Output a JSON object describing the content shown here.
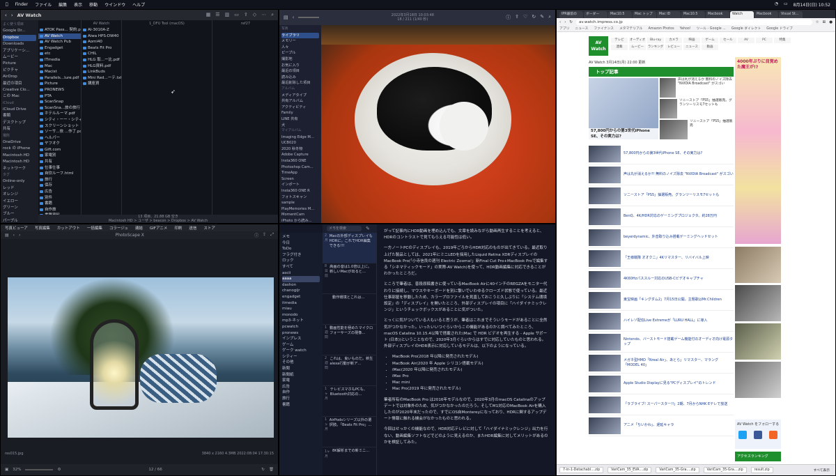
{
  "menubar": {
    "app": "Finder",
    "items": [
      "ファイル",
      "編集",
      "表示",
      "移動",
      "ウインドウ",
      "ヘルプ"
    ],
    "clock": "8月14日(日) 10:52"
  },
  "finder": {
    "title": "AV Watch",
    "sidebar": [
      "よく使う項目",
      "Google Dr...",
      "Dropbox",
      "Downloads",
      "アプリケーシ...",
      "ムービー",
      "Picture",
      "ピクチャ",
      "AirDrop",
      "最近の項目",
      "Creative Clo...",
      "この Mac",
      "iCloud",
      "iCloud Drive",
      "書類",
      "デスクトップ",
      "共有",
      "場所",
      "OneDrive",
      "rock の iPhone",
      "Macintosh HD",
      "Macintosh HD",
      "ネットワーク",
      "タグ",
      "Online-only",
      "レッド",
      "オレンジ",
      "イエロー",
      "グリーン",
      "ブルー",
      "パープル",
      "すべてのタグ..."
    ],
    "col_headers": [
      "",
      "AV Watch",
      "1_DFU Tool (macOS)",
      "ref27"
    ],
    "col1": [
      "ATOK Pass... 契約.pdf",
      "AV Watch",
      "AV Watch Pub",
      "Engadget",
      "etc",
      "ITmedia",
      "Mac",
      "Macist",
      "Parallels...lure.pdf",
      "Picture",
      "PRONEWS",
      "PTA",
      "ScanSnap",
      "ScanSna...旅の旅行",
      "ホテルルーマ.pdf",
      "シティ・ーー・シティ",
      "スクリーンショット",
      "ソーサ...依 ...作了.pdf",
      "ヘルパー",
      "ヤフオク",
      "Gift.com",
      "家電別",
      "共有",
      "仕事仕事",
      "自炊ルーフ.html",
      "旅行",
      "保存",
      "広告",
      "別件",
      "書籍",
      "自作旅",
      "書籍資料",
      "自身仕事",
      "写真",
      "夏休",
      "旅行",
      "タグ"
    ],
    "col2": [
      "AI-3010A-Z",
      "Aiwa HPS-DW40",
      "Aomi40",
      "Beats Fit Pro",
      "CHIL",
      "HLG 取...ー比.pdf",
      "HLG資料.pdf",
      "LinkBuds",
      "Mini Red...ーテ.txt",
      "講座資"
    ],
    "status": "13 項目、21.88 GB 空き",
    "path": "Macintosh HD > ユーザ > beacon > Dropbox > AV Watch"
  },
  "viewer": {
    "tabs": [
      "写真ビューア",
      "写真編集",
      "カットアウト",
      "一括編集",
      "コラージュ",
      "連結",
      "GIFアニメ",
      "印刷",
      "送信",
      "ストア"
    ],
    "window_title": "PhotoScape X",
    "filename": "res015.jpg",
    "info": "3840 x 2160   4.3MB   2022:08:04 17:30:15",
    "zoom": "32%",
    "page": "12 / 66"
  },
  "photos": {
    "date_line1": "2022年3月18日 10:03:48",
    "date_line2": "18 / 211 (1/40 秒)",
    "sidebar": [
      "写真",
      "ライブラリ",
      "メモリー",
      "人々",
      "ピープル",
      "撮影地",
      "お気に入り",
      "最近の項目",
      "読み込み",
      "最近削除した項目",
      "アルバム",
      "メディアタイプ",
      "共有アルバム",
      "アクティビティ",
      "Family",
      "LINE 共有",
      "犬",
      "マイアルバム",
      "Imaging Edge M...",
      "UCB020",
      "2020 秋冬物",
      "Adobe Capture",
      "Insta360 ONE",
      "Photoshop Cam...",
      "TimeApp",
      "Screen",
      "インポート",
      "Insta360 ONE R",
      "フォトスキャン",
      "sample",
      "PlayMemories M...",
      "MomentCam",
      "iPhoto から読み...",
      "FILMIC Pro"
    ]
  },
  "notes": {
    "search": "メモを検索",
    "sidebar": [
      "メモ",
      "今日",
      "ToDo",
      "フラグ付き",
      "ロック",
      "すべて",
      "ascii",
      "aaaa",
      "dashon",
      "chanogijr",
      "engadget",
      "itmedia",
      "miau",
      "monodo",
      "mp3-ネット",
      "pcwatch",
      "pronews",
      "インプレス",
      "ゲーム",
      "ゲーク watch",
      "シティー",
      "その他",
      "新聞",
      "新聞紙",
      "家電",
      "広告",
      "自作",
      "旅行",
      "書籍"
    ],
    "list": [
      {
        "date": "2月",
        "title": "Macの外部ディスプレイもHDRに。これでHDR編集できる!!!"
      },
      {
        "date": "8日前",
        "title": "高画の音は1.0倍以上に。新しいMacが出ると..."
      },
      {
        "date": "",
        "title": "動作環境とこれは..."
      },
      {
        "date": "1週間",
        "title": "動画性能を極めたマイクロフォーサーズの現像..."
      },
      {
        "date": "2週間",
        "title": "これは、良いものだ。新生alexa行動が新ア..."
      },
      {
        "date": "1ヶ月",
        "title": "テレビスマホもPCも、Bluetooth対応の..."
      },
      {
        "date": "1ヶ月",
        "title": "AirPodsシリーズ以外の選択肢。「Beats Fit Pro」..."
      },
      {
        "date": "1ヶ月",
        "title": "8K解析までの新ミニ..."
      }
    ],
    "p1": "がって記事内にHDR動画を埋め込んでも、文章を読みながら動画再生することを考えると、HDRのコントラストで見てもらえる可能性は低い。",
    "p2": "一方ノートPCのディスプレイも、2019年ごろからHDR対応のものが出てきている。最近取り上げた製品としては、2021年にミニLEDを採用したLiquid Retina XDRディスプレイのMacBook Pro(「小寺信良の週刊 Electric Zooma!」新Final Cut Pro+MacBook Proで編集する「シネマティックモード」の実際-AV Watch)を使って、HDR動画編集に対応できることがわかったところだ。",
    "p2_link": "新Final Cut Pro+MacBook Proで編集する「シネマティックモード」の実際-AV Watch",
    "p3": "ところで筆者は、普段原稿書きに使っているMacBook Airに40インチのREGZAをモニター代わりに接続し、マウスやキーボードを別に繋いでいわゆるクローズド状態で使っている。最近仕事部屋を移動したため、カラープロファイルを見直しておこうと久しぶりに「システム環境設定」の「ディスプレイ」を開いたところ、外部ディスプレイの項目に「ハイダイナミックレンジ」というチェックボックスがあることに気がついた。",
    "p4": "とっくに気がついている人もいると思うが、筆者はこれまでそういうモードがあることに全然気がつかなかった。いったいいつぐらいからこの機能があるのかと調べてみたところ、macOS Catalina 10.15.4以降で搭載された(Mac で HDR ビデオを再生する - Apple サポート (日本))ということなので、2020年3月ぐらいからはすでに対応していたものと思われる。外部ディスプレイのHDR表示に対応しているモデルは、以下のようになっている。",
    "list_items": [
      "MacBook Pro(2018 年以降に発売されたモデル)",
      "MacBook Air(2020 年 Apple シリコン搭載モデル)",
      "iMac(2020 年以降に発売されたモデル)",
      "iMac Pro",
      "Mac mini",
      "Mac Pro(2019 年に発売されたモデル)"
    ],
    "p5": "筆者所有のMacBook Pro は2016年モデルなので、2020年3月のmacOS Catalinaのアップデートでは対象外のため、気がつかなかったのだろう。そしてM1対応のMacBook Airを購入したのが2020年末だったので、すでにOS自Montereyになっており、HDRに関するアップデート情報に触れる機会がなかったものと思われる。",
    "p6": "今回はせっかくの機能なので、HDR対応テレビに対して「ハイダイナミックレンジ」出力を行ない、動画編集ソフトなどでどのように見えるのか、またHDR編集に対してメリットがあるのかを検証してみた。"
  },
  "browser": {
    "tabs": [
      "IPR最前の",
      "ボーダー",
      "Mac10.5",
      "Mac トップ",
      "Mac ID",
      "Mac10.5",
      "Macbook",
      "Watch",
      "Macbook",
      "Visual St..."
    ],
    "url": "av.watch.impress.co.jp",
    "bookmarks": [
      "アプリ",
      "ニュース",
      "ファイナンス",
      "メタマテリアル",
      "Amazon Photos",
      "Yahoo!",
      "ツール - Google ...",
      "Google ダイレクト",
      "Google ドライブ"
    ],
    "logo": "AV Watch",
    "nav": [
      "テレビ",
      "オーディオ",
      "Blu-ray",
      "カメラ",
      "映画",
      "ゲーム",
      "セール",
      "AV",
      "PC",
      "特集",
      "連載",
      "ムービー",
      "ランキング",
      "レビュー",
      "ニュース",
      "動画"
    ],
    "date": "AV Watch 3月14日(月) 22:00 更新",
    "section": "トップ記事",
    "hero_caption": "57,800円からの第3世代iPhone SE、その実力は?",
    "minis": [
      "声は丸が消えるか 無料のノイズ除去 \"NVIDIA Broadcast\" がスゴい",
      "ソニーストア「PS5」抽選販売。グランツーリスモ7セットも",
      "ソニーストア「PS5」抽選販売"
    ],
    "articles": [
      "57,800円からの第3世代iPhone SE、その実力は?",
      "声は丸が消えるか?! 無料のノイズ除去 \"NVIDIA Broadcast\" がスゴい",
      "ソニーストア「PS5」抽選販売。グランツーリスモ7セットも",
      "BenQ、4K/HDR対応のゲーミングプロジェクタ。約28万円",
      "beyerdynamic、外音取り込み搭載ゲーミングヘッドセット",
      "「王様戦隊 オオクニ」4Kリマスター、リバイバル上映",
      "4K60Hzパススルー対応のUSB-Cビデオキャプチャ",
      "東宝映画「キングダム2」7月15日公開。主題歌はMr.Children",
      "ハイレゾ配信Live Extremeが「LURU HALL」に導入",
      "Nintendo、バーストモード搭載ゲーム機能付のオーディオ向け電源タップ",
      "メガネ型HMD「Nreal Air」、あとら」リマスター、マラング「MODEL 40」",
      "Apple Studio Displayに見る\"PCディスプレイ\"のトレンド",
      "「ラブライブ! スーパースター!!」2期、7月からNHK Eテレで放送",
      "アニメ「ちいかわ」、遅延キャラ"
    ],
    "ads_text": "4000年ぶりに目覚めた魔王が!?",
    "follow": "AV Watch をフォローする",
    "ranking": "アクセスランキング",
    "downloads": [
      "7-in-1-Detachabl....zip",
      "VariCam_35_EVA....zip",
      "VariCam_35-Gra....zip",
      "VariCam_35-Gra....zip",
      "result.zip"
    ],
    "show_all": "すべて表示"
  }
}
